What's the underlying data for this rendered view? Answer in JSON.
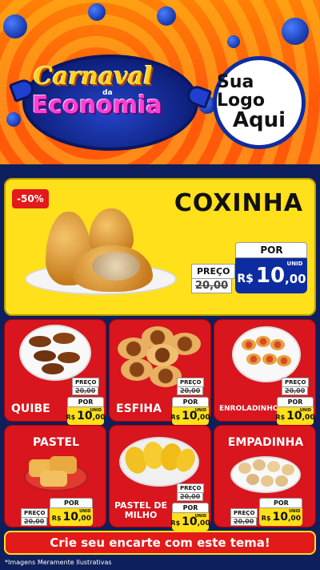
{
  "header": {
    "brand_word_1": "Carnaval",
    "brand_word_small": "da",
    "brand_word_2": "Economia",
    "logo_line_1": "Sua Logo",
    "logo_line_2": "Aqui"
  },
  "hero": {
    "discount_tag": "-50%",
    "product_name": "COXINHA",
    "old_price_label": "PREÇO",
    "old_price": "20,00",
    "new_price_label": "POR",
    "currency": "R$",
    "price_int": "10",
    "price_cents": ",00",
    "unit": "UNID"
  },
  "cards": [
    {
      "name": "QUIBE",
      "old_label": "PREÇO",
      "old_price": "20,00",
      "new_label": "POR",
      "currency": "R$",
      "price_int": "10",
      "price_cents": ",00",
      "unit": "UNID"
    },
    {
      "name": "ESFIHA",
      "old_label": "PREÇO",
      "old_price": "20,00",
      "new_label": "POR",
      "currency": "R$",
      "price_int": "10",
      "price_cents": ",00",
      "unit": "UNID"
    },
    {
      "name": "ENROLADINHO",
      "old_label": "PREÇO",
      "old_price": "20,00",
      "new_label": "POR",
      "currency": "R$",
      "price_int": "10",
      "price_cents": ",00",
      "unit": "UNID"
    },
    {
      "name": "PASTEL",
      "old_label": "PREÇO",
      "old_price": "20,00",
      "new_label": "POR",
      "currency": "R$",
      "price_int": "10",
      "price_cents": ",00",
      "unit": "UNID"
    },
    {
      "name_line_1": "PASTEL DE",
      "name_line_2": "MILHO",
      "old_label": "PREÇO",
      "old_price": "20,00",
      "new_label": "POR",
      "currency": "R$",
      "price_int": "10",
      "price_cents": ",00",
      "unit": "UNID"
    },
    {
      "name": "EMPADINHA",
      "old_label": "PREÇO",
      "old_price": "20,00",
      "new_label": "POR",
      "currency": "R$",
      "price_int": "10",
      "price_cents": ",00",
      "unit": "UNID"
    }
  ],
  "cta": {
    "label": "Crie seu encarte com este tema!"
  },
  "footer": {
    "disclaimer": "*Imagens Meramente Ilustrativas"
  },
  "colors": {
    "accent_red": "#d9151d",
    "accent_yellow": "#ffe01a",
    "navy": "#0d1f5c",
    "price_blue": "#0d2ca0"
  }
}
